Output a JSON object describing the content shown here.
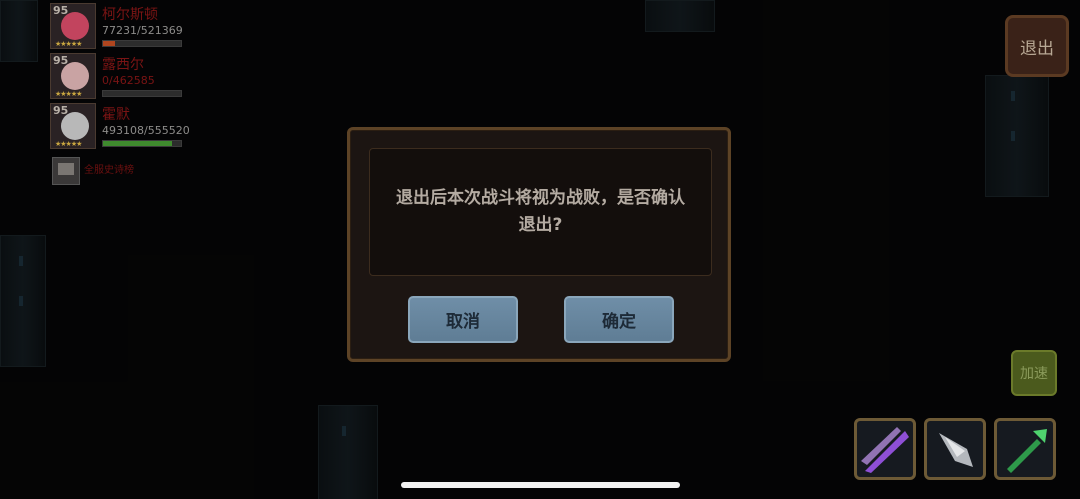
{
  "party": [
    {
      "level": "95",
      "name": "柯尔斯顿",
      "hp": "77231/521369",
      "hp_fraction": 0.15,
      "bar_color": "#b0461f",
      "face_color": "#c2445e",
      "stars": "★★★★★"
    },
    {
      "level": "95",
      "name": "露西尔",
      "hp": "0/462585",
      "hp_fraction": 0.0,
      "bar_color": "#3f8a2e",
      "face_color": "#c9a3a3",
      "stars": "★★★★★"
    },
    {
      "level": "95",
      "name": "霍默",
      "hp": "493108/555520",
      "hp_fraction": 0.89,
      "bar_color": "#3f8a2e",
      "face_color": "#b8b8b8",
      "stars": "★★★★★"
    }
  ],
  "record": {
    "label": "全服史诗榜"
  },
  "exit_button": {
    "label": "退出"
  },
  "speed_button": {
    "label": "加速"
  },
  "skills": [
    {
      "icon": "purple-slash-icon"
    },
    {
      "icon": "silver-blade-icon"
    },
    {
      "icon": "green-arrow-icon"
    }
  ],
  "dialog": {
    "message": "退出后本次战斗将视为战败，是否确认退出?",
    "cancel_label": "取消",
    "confirm_label": "确定"
  }
}
